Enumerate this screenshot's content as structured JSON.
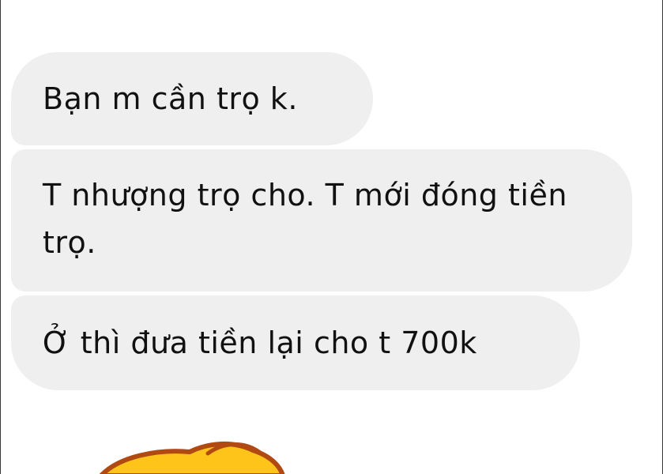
{
  "messages": [
    {
      "text": "Bạn m cần trọ k."
    },
    {
      "text": "T nhượng trọ cho. T mới đóng tiền trọ."
    },
    {
      "text": "Ở thì đưa tiền lại cho t 700k"
    }
  ],
  "sticker": {
    "icon": "yellow-character-sticker-icon",
    "colors": {
      "fill": "#ffc41a",
      "outline": "#b04a12"
    }
  },
  "colors": {
    "bubble_background": "#efefef",
    "text": "#111111",
    "page_background": "#ffffff"
  }
}
